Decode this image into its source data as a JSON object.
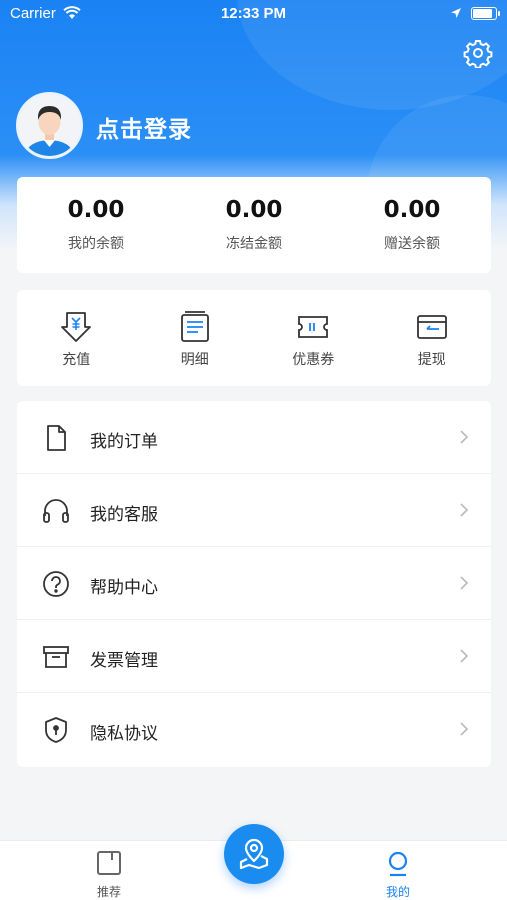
{
  "status_bar": {
    "carrier": "Carrier",
    "time": "12:33 PM"
  },
  "profile": {
    "login_text": "点击登录"
  },
  "balances": [
    {
      "value": "0.00",
      "label": "我的余额"
    },
    {
      "value": "0.00",
      "label": "冻结金额"
    },
    {
      "value": "0.00",
      "label": "赠送余额"
    }
  ],
  "actions": [
    {
      "label": "充值",
      "icon": "recharge-icon"
    },
    {
      "label": "明细",
      "icon": "details-icon"
    },
    {
      "label": "优惠券",
      "icon": "coupon-icon"
    },
    {
      "label": "提现",
      "icon": "withdraw-icon"
    }
  ],
  "menu": [
    {
      "label": "我的订单",
      "icon": "document-icon"
    },
    {
      "label": "我的客服",
      "icon": "headphones-icon"
    },
    {
      "label": "帮助中心",
      "icon": "help-icon"
    },
    {
      "label": "发票管理",
      "icon": "archive-box-icon"
    },
    {
      "label": "隐私协议",
      "icon": "shield-icon"
    }
  ],
  "tabbar": {
    "tabs": [
      {
        "label": "推荐",
        "icon": "recommend-icon",
        "active": false
      },
      {
        "label": "我的",
        "icon": "user-icon",
        "active": true
      }
    ],
    "center_icon": "map-pin-icon"
  },
  "colors": {
    "primary": "#1a82f3",
    "background": "#f4f5f7"
  }
}
